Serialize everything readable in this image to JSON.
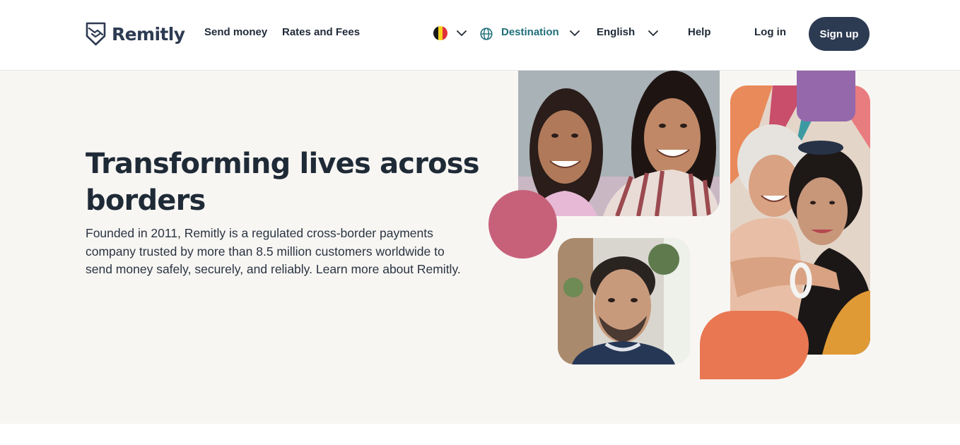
{
  "brand": {
    "name": "Remitly",
    "logo_icon": "shield-handshake-icon"
  },
  "nav": {
    "send_money": "Send money",
    "rates_fees": "Rates and Fees",
    "country_flag": "belgium-flag-icon",
    "destination": "Destination",
    "language": "English",
    "help": "Help",
    "login": "Log in",
    "signup": "Sign up"
  },
  "hero": {
    "title": "Transforming lives across borders",
    "description": "Founded in 2011, Remitly is a regulated cross-border payments company trusted by more than 8.5 million customers worldwide to send money safely, securely, and reliably. Learn more about Remitly.",
    "images": [
      "two smiling young women",
      "portrait of a man",
      "two older women embracing"
    ]
  },
  "colors": {
    "brand_navy": "#2d3b52",
    "destination_teal": "#1f6e7a",
    "hero_bg": "#f8f6f3",
    "shape_pink": "#c7617a",
    "shape_purple": "#9468ab",
    "shape_orange": "#e97752"
  }
}
